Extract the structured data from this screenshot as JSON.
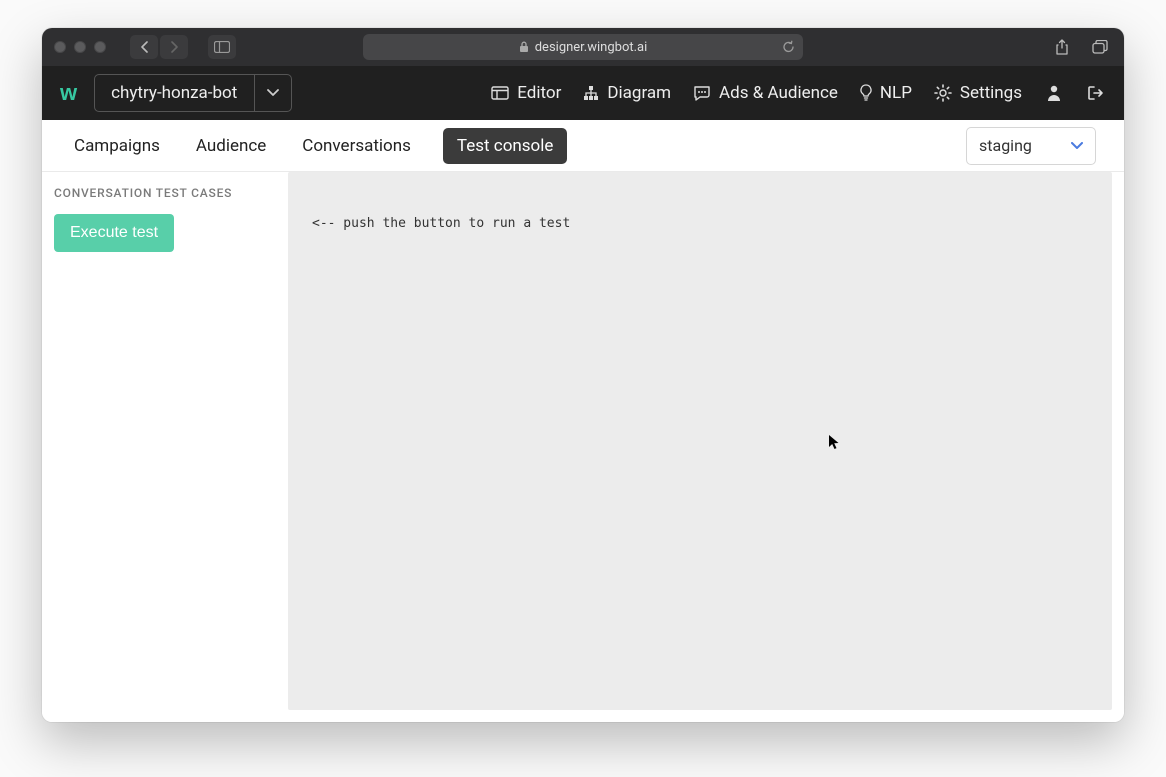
{
  "browser": {
    "url": "designer.wingbot.ai"
  },
  "app": {
    "logo": "w",
    "project_name": "chytry-honza-bot",
    "nav": {
      "editor": "Editor",
      "diagram": "Diagram",
      "ads": "Ads & Audience",
      "nlp": "NLP",
      "settings": "Settings"
    }
  },
  "subnav": {
    "tabs": {
      "campaigns": "Campaigns",
      "audience": "Audience",
      "conversations": "Conversations",
      "test_console": "Test console"
    },
    "environment": "staging"
  },
  "sidebar": {
    "heading": "CONVERSATION TEST CASES",
    "execute_label": "Execute test"
  },
  "console": {
    "hint": "<-- push the button to run a test"
  }
}
